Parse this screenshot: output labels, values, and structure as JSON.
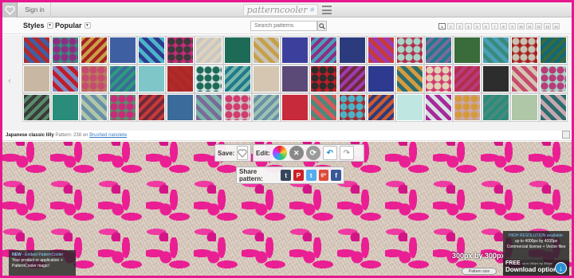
{
  "header": {
    "signin_label": "Sign in",
    "logo_text": "patterncooler",
    "logo_snowflake": "❄"
  },
  "nav": {
    "styles_label": "Styles",
    "popular_label": "Popular",
    "search_placeholder": "Search patterns",
    "pages": [
      "1",
      "2",
      "3",
      "4",
      "5",
      "6",
      "7",
      "8",
      "9",
      "10",
      "11",
      "12",
      "13",
      "14"
    ],
    "active_page": "1"
  },
  "gallery": {
    "tile_colors": [
      "#b22a2a",
      "#3a8a7c",
      "#c7a04a",
      "#3f5fa3",
      "#4bb3c7",
      "#c92a7a",
      "#e0d3ba",
      "#1d6b57",
      "#c7c2b3",
      "#3d3f9c",
      "#8e2d84",
      "#2c3b7d",
      "#c63a3a",
      "#b32d4c",
      "#1f7a8c",
      "#3a6b3a",
      "#4aa0b8",
      "#a72020",
      "#12677a",
      "#c8b8a3",
      "#7b89c2",
      "#b87c5a",
      "#2e9a7c",
      "#7ec6c8",
      "#ab2828",
      "#d7e3e3",
      "#79b6a8",
      "#d4c6b0",
      "#5b4a78",
      "#c01d2a",
      "#9d3bb0",
      "#2d3a8f",
      "#d69a3e",
      "#d23c6d",
      "#b73c7a",
      "#2d2d2d",
      "#c74b6f",
      "#a7d4c6",
      "#3b3b3b",
      "#2a8c7a",
      "#6a8fa8",
      "#5a8c6b",
      "#6e2a3a",
      "#3a6b9a",
      "#7a6a9a",
      "#c7c7c7",
      "#9ec3b0",
      "#c72a3a",
      "#d85a5a",
      "#a82a2a",
      "#cc5b2e",
      "#bfe6e0",
      "#a72a9a",
      "#c7a7b0",
      "#4a8a7c",
      "#b0c7a7",
      "#2b6d6d"
    ],
    "caption_title": "Japanese classic lilly",
    "caption_meta": "Pattern: 238",
    "caption_on": "on",
    "caption_link": "Brushed nanolete"
  },
  "toolbar": {
    "save_label": "Save:",
    "edit_label": "Edit:",
    "share_label": "Share pattern:"
  },
  "promo": {
    "new_label": "NEW",
    "new_text": "- Embed PatternCooler",
    "line2": "Your product or application +",
    "line3": "PatternCooler magic!"
  },
  "size_info": {
    "size_text": "300px by 300px",
    "pattern_size_label": "Pattern size"
  },
  "hd": {
    "line1": "HIGH RESOLUTION available:",
    "line2": "up to 4000px by 4000px",
    "line3": "Commercial license + Vector files"
  },
  "download": {
    "free_label": "FREE",
    "free_sub": "up to 300px by 300px",
    "download_label": "Download options"
  },
  "colors": {
    "border_pink": "#e5188f",
    "pattern_pink": "#ea1f93",
    "pattern_bg": "#dccfc3"
  }
}
